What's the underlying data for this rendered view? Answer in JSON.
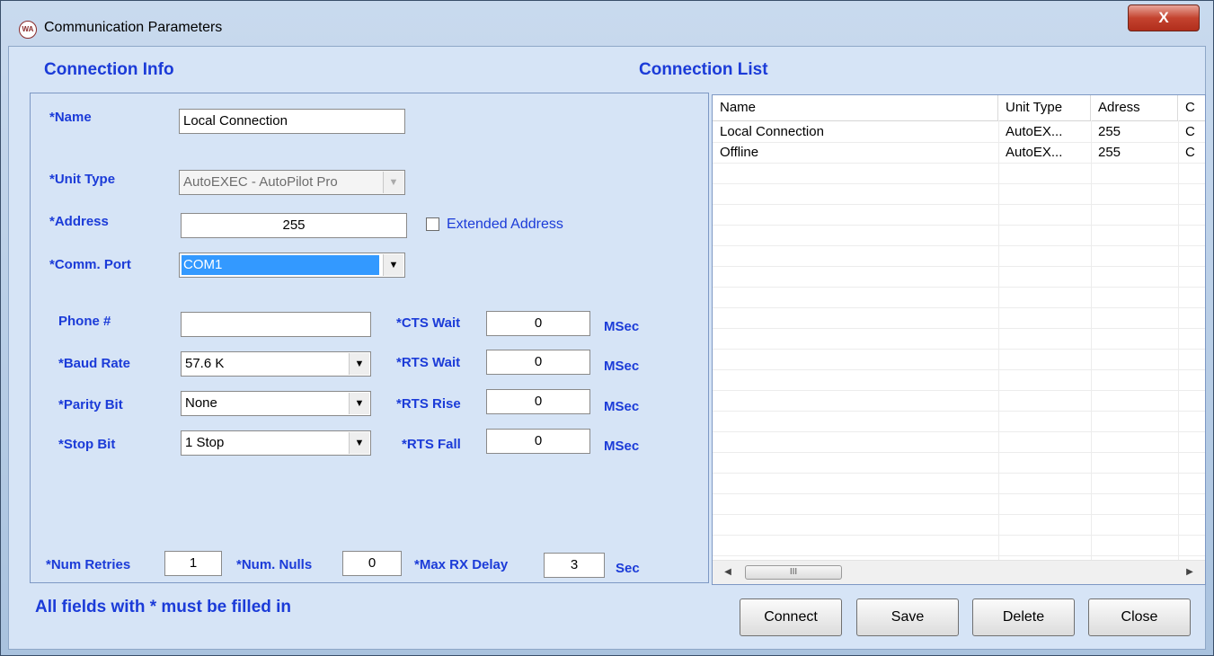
{
  "window": {
    "title": "Communication Parameters",
    "icon": "wa-logo-icon",
    "close_label": "X"
  },
  "connection_info": {
    "title": "Connection Info",
    "name": {
      "label": "*Name",
      "value": "Local Connection"
    },
    "unit_type": {
      "label": "*Unit Type",
      "value": "AutoEXEC - AutoPilot Pro"
    },
    "address": {
      "label": "*Address",
      "value": "255",
      "extended_label": "Extended Address",
      "extended_checked": false
    },
    "comm_port": {
      "label": "*Comm. Port",
      "value": "COM1"
    },
    "phone": {
      "label": "Phone #",
      "value": ""
    },
    "baud_rate": {
      "label": "*Baud Rate",
      "value": "57.6 K"
    },
    "parity_bit": {
      "label": "*Parity Bit",
      "value": "None"
    },
    "stop_bit": {
      "label": "*Stop Bit",
      "value": "1 Stop"
    },
    "cts_wait": {
      "label": "*CTS Wait",
      "value": "0",
      "unit": "MSec"
    },
    "rts_wait": {
      "label": "*RTS Wait",
      "value": "0",
      "unit": "MSec"
    },
    "rts_rise": {
      "label": "*RTS Rise",
      "value": "0",
      "unit": "MSec"
    },
    "rts_fall": {
      "label": "*RTS Fall",
      "value": "0",
      "unit": "MSec"
    },
    "num_retries": {
      "label": "*Num Retries",
      "value": "1"
    },
    "num_nulls": {
      "label": "*Num. Nulls",
      "value": "0"
    },
    "max_rx_delay": {
      "label": "*Max RX Delay",
      "value": "3",
      "unit": "Sec"
    }
  },
  "footnote": "All fields with * must be filled in",
  "connection_list": {
    "title": "Connection List",
    "columns": [
      "Name",
      "Unit Type",
      "Adress",
      "C"
    ],
    "rows": [
      [
        "Local Connection",
        "AutoEX...",
        "255",
        "C"
      ],
      [
        "Offline",
        "AutoEX...",
        "255",
        "C"
      ]
    ],
    "scroll_thumb": "III"
  },
  "buttons": {
    "connect": "Connect",
    "save": "Save",
    "delete": "Delete",
    "close": "Close"
  }
}
